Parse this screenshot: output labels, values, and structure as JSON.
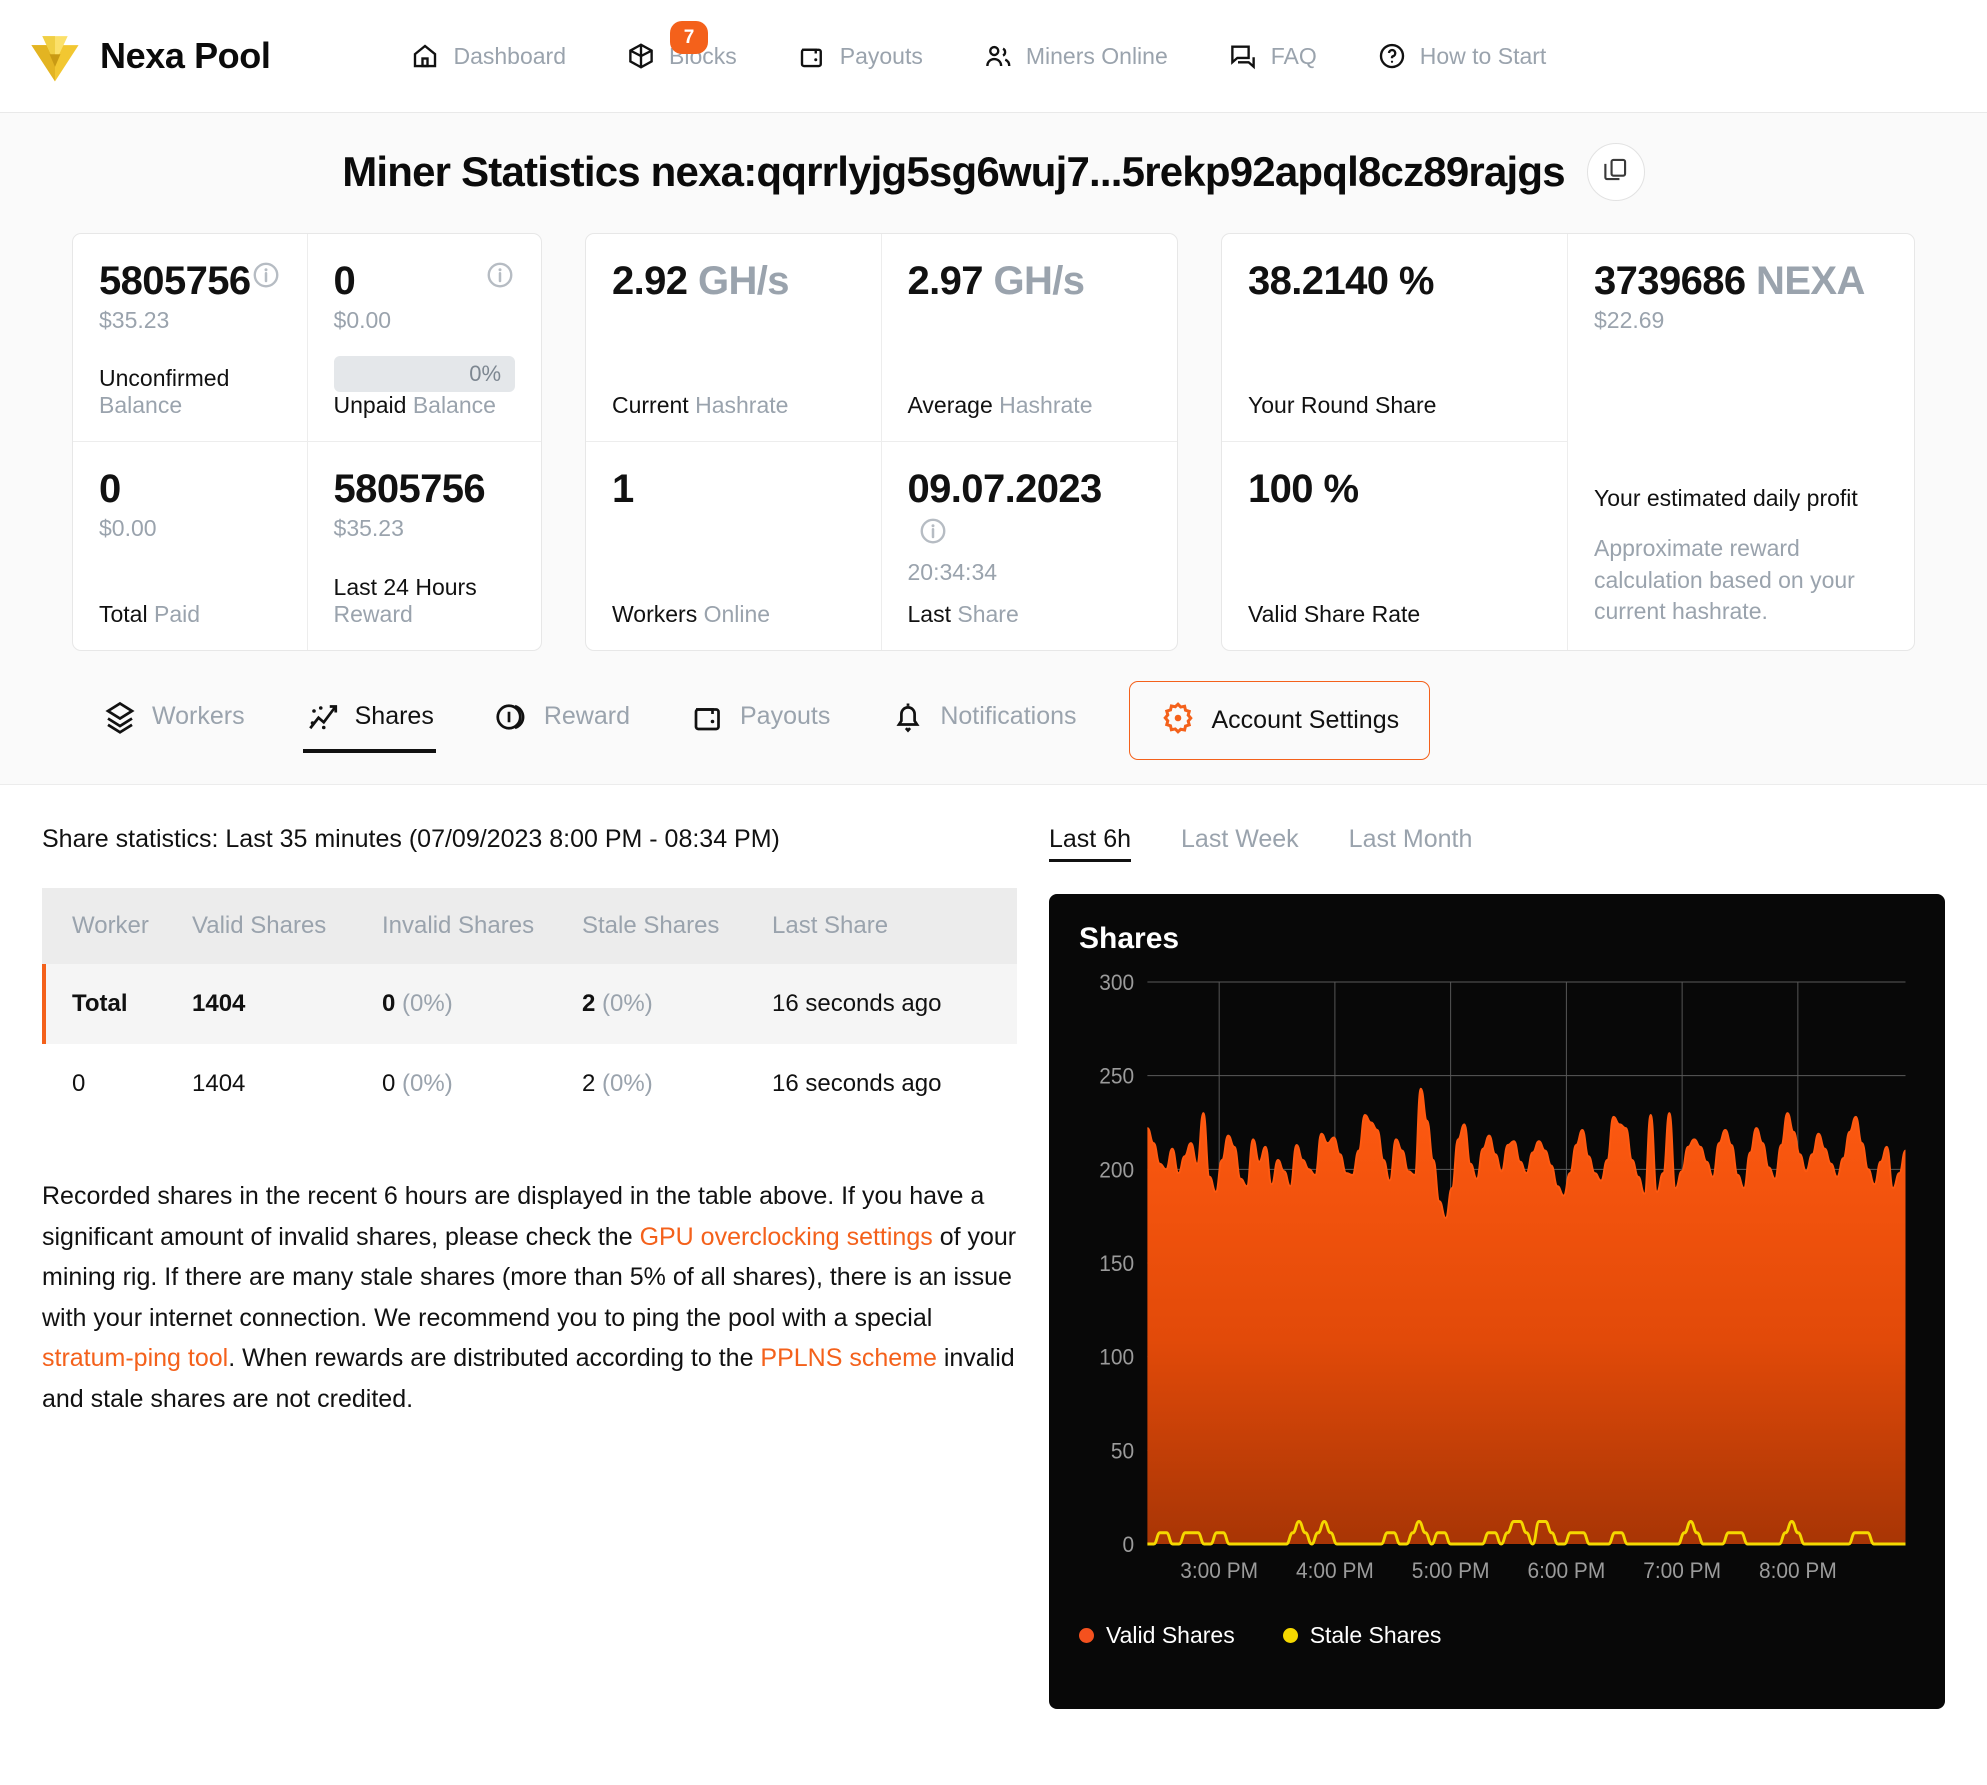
{
  "brand": {
    "name": "Nexa Pool",
    "logo_icon": "nexa-logo-icon"
  },
  "nav": {
    "items": [
      {
        "label": "Dashboard",
        "icon": "home-icon",
        "badge": null
      },
      {
        "label": "Blocks",
        "icon": "cube-icon",
        "badge": "7"
      },
      {
        "label": "Payouts",
        "icon": "wallet-icon",
        "badge": null
      },
      {
        "label": "Miners Online",
        "icon": "users-icon",
        "badge": null
      },
      {
        "label": "FAQ",
        "icon": "chat-icon",
        "badge": null
      },
      {
        "label": "How to Start",
        "icon": "question-circle-icon",
        "badge": null
      }
    ]
  },
  "panel": {
    "title": "Miner Statistics nexa:qqrrlyjg5sg6wuj7...5rekp92apql8cz89rajgs",
    "copy_icon": "copy-icon",
    "cards": {
      "unconfirmed_balance": {
        "value": "5805756",
        "sub": "$35.23",
        "label_strong": "Unconfirmed",
        "label_muted": "Balance",
        "info_icon": "info-icon"
      },
      "unpaid_balance": {
        "value": "0",
        "sub": "$0.00",
        "progress_text": "0%",
        "progress_pct": 0,
        "label_strong": "Unpaid",
        "label_muted": "Balance",
        "info_icon": "info-icon"
      },
      "total_paid": {
        "value": "0",
        "sub": "$0.00",
        "label_strong": "Total",
        "label_muted": "Paid"
      },
      "last_24_hours_reward": {
        "value": "5805756",
        "sub": "$35.23",
        "label_strong": "Last 24 Hours",
        "label_muted": "Reward"
      },
      "current_hashrate": {
        "value": "2.92",
        "unit": "GH/s",
        "label_strong": "Current",
        "label_muted": "Hashrate"
      },
      "average_hashrate": {
        "value": "2.97",
        "unit": "GH/s",
        "label_strong": "Average",
        "label_muted": "Hashrate"
      },
      "workers_online": {
        "value": "1",
        "label_strong": "Workers",
        "label_muted": "Online"
      },
      "last_share": {
        "value": "09.07.2023",
        "sub": "20:34:34",
        "label_strong": "Last",
        "label_muted": "Share",
        "info_icon": "info-icon"
      },
      "round_share": {
        "value": "38.2140 %",
        "label_strong": "Your Round Share"
      },
      "valid_share_rate": {
        "value": "100 %",
        "label_strong": "Valid Share Rate"
      },
      "daily_profit": {
        "value": "3739686",
        "unit": "NEXA",
        "sub": "$22.69",
        "title": "Your estimated daily profit",
        "desc": "Approximate reward calculation based on your current hashrate."
      }
    }
  },
  "subtabs": {
    "items": [
      {
        "label": "Workers",
        "icon": "layers-icon",
        "active": false
      },
      {
        "label": "Shares",
        "icon": "scatter-chart-icon",
        "active": true
      },
      {
        "label": "Reward",
        "icon": "coins-icon",
        "active": false
      },
      {
        "label": "Payouts",
        "icon": "wallet-icon",
        "active": false
      },
      {
        "label": "Notifications",
        "icon": "bell-icon",
        "active": false
      }
    ],
    "settings_button": {
      "label": "Account Settings",
      "icon": "gear-icon"
    }
  },
  "share_statistics": {
    "heading": "Share statistics: Last 35 minutes (07/09/2023 8:00 PM - 08:34 PM)",
    "columns": [
      "Worker",
      "Valid Shares",
      "Invalid Shares",
      "Stale Shares",
      "Last Share"
    ],
    "rows": [
      {
        "worker": "Total",
        "valid": "1404",
        "invalid": "0",
        "invalid_pct": "(0%)",
        "stale": "2",
        "stale_pct": "(0%)",
        "last_share": "16 seconds ago",
        "is_total": true
      },
      {
        "worker": "0",
        "valid": "1404",
        "invalid": "0",
        "invalid_pct": "(0%)",
        "stale": "2",
        "stale_pct": "(0%)",
        "last_share": "16 seconds ago",
        "is_total": false
      }
    ],
    "note": {
      "part1": "Recorded shares in the recent 6 hours are displayed in the table above. If you have a significant amount of invalid shares, please check the ",
      "link1": "GPU overclocking settings",
      "part2": " of your mining rig. If there are many stale shares (more than 5% of all shares), there is an issue with your internet connection. We recommend you to ping the pool with a special ",
      "link2": "stratum-ping tool",
      "part3": ". When rewards are distributed according to the ",
      "link3": "PPLNS scheme",
      "part4": " invalid and stale shares are not credited."
    }
  },
  "chart_panel": {
    "tabs": [
      {
        "label": "Last 6h",
        "active": true
      },
      {
        "label": "Last Week",
        "active": false
      },
      {
        "label": "Last Month",
        "active": false
      }
    ]
  },
  "colors": {
    "accent": "#f4611b",
    "valid_shares": "#f4511e",
    "stale_shares": "#f5d800",
    "chart_bg": "#080808",
    "muted_text": "#9aa3ad"
  },
  "chart_data": {
    "type": "area",
    "title": "Shares",
    "xlabel": "",
    "ylabel": "",
    "ylim": [
      0,
      300
    ],
    "yticks": [
      0,
      50,
      100,
      150,
      200,
      250,
      300
    ],
    "xticks": [
      "3:00 PM",
      "4:00 PM",
      "5:00 PM",
      "6:00 PM",
      "7:00 PM",
      "8:00 PM"
    ],
    "grid": true,
    "legend_position": "bottom-left",
    "legend": [
      "Valid Shares",
      "Stale Shares"
    ],
    "series": [
      {
        "name": "Valid Shares",
        "color": "#f4511e",
        "values": [
          222,
          214,
          203,
          200,
          211,
          198,
          207,
          214,
          203,
          230,
          196,
          188,
          205,
          218,
          212,
          195,
          191,
          216,
          204,
          212,
          192,
          205,
          199,
          191,
          213,
          205,
          200,
          197,
          219,
          214,
          217,
          208,
          198,
          197,
          210,
          229,
          225,
          221,
          205,
          194,
          216,
          210,
          199,
          197,
          243,
          226,
          205,
          183,
          174,
          190,
          216,
          224,
          203,
          195,
          211,
          218,
          208,
          199,
          213,
          215,
          204,
          198,
          209,
          215,
          210,
          202,
          191,
          186,
          198,
          213,
          221,
          207,
          198,
          194,
          205,
          228,
          224,
          222,
          205,
          196,
          187,
          229,
          188,
          198,
          230,
          190,
          199,
          212,
          216,
          212,
          204,
          196,
          214,
          221,
          213,
          197,
          190,
          209,
          222,
          214,
          201,
          195,
          213,
          230,
          220,
          208,
          199,
          208,
          219,
          211,
          203,
          196,
          206,
          220,
          228,
          214,
          200,
          192,
          204,
          212,
          190,
          198,
          210
        ]
      },
      {
        "name": "Stale Shares",
        "color": "#f5d800",
        "values": [
          0,
          0,
          1,
          1,
          0,
          0,
          1,
          1,
          1,
          0,
          0,
          1,
          1,
          0,
          0,
          0,
          0,
          0,
          0,
          0,
          0,
          0,
          0,
          1,
          2,
          1,
          0,
          1,
          2,
          1,
          0,
          0,
          0,
          0,
          0,
          0,
          0,
          0,
          1,
          1,
          0,
          0,
          1,
          2,
          1,
          0,
          1,
          1,
          0,
          0,
          0,
          0,
          0,
          0,
          1,
          1,
          0,
          1,
          2,
          2,
          1,
          0,
          2,
          2,
          1,
          0,
          0,
          1,
          1,
          1,
          0,
          0,
          0,
          0,
          1,
          1,
          0,
          0,
          0,
          0,
          0,
          0,
          0,
          0,
          0,
          1,
          2,
          1,
          0,
          0,
          0,
          0,
          1,
          1,
          1,
          0,
          0,
          0,
          0,
          0,
          0,
          1,
          2,
          1,
          0,
          0,
          0,
          0,
          0,
          0,
          0,
          0,
          1,
          1,
          1,
          0,
          0,
          0,
          0,
          0,
          0
        ]
      }
    ]
  }
}
